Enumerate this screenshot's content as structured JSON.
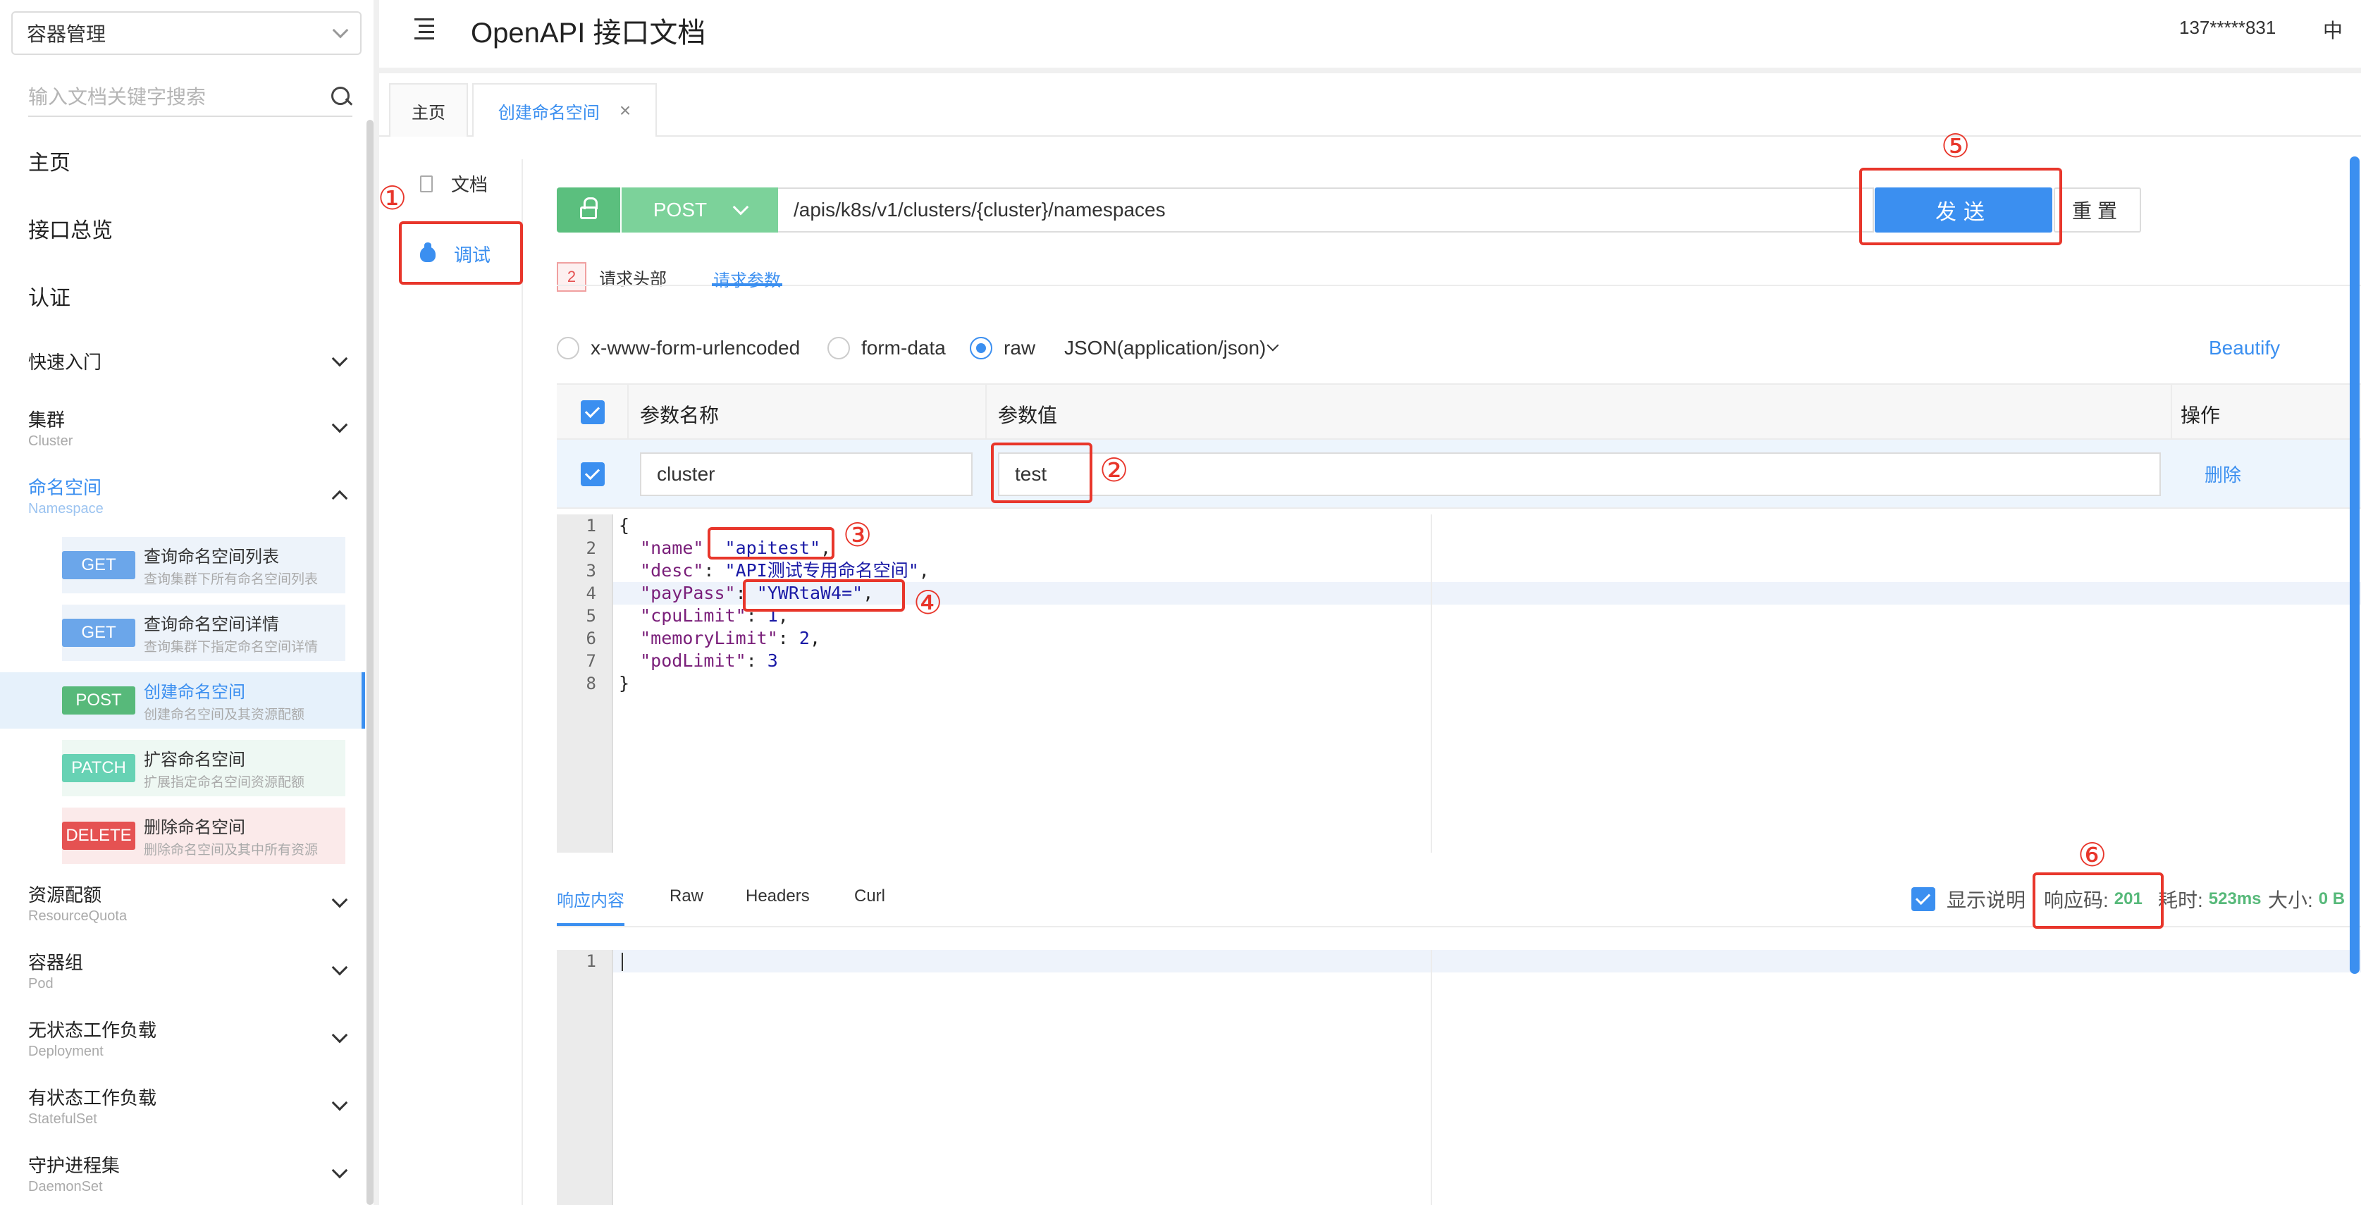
{
  "sidebar": {
    "project": "容器管理",
    "search_placeholder": "输入文档关键字搜索",
    "top_items": [
      "主页",
      "接口总览",
      "认证"
    ],
    "groups": [
      {
        "title": "快速入门",
        "sub": ""
      },
      {
        "title": "集群",
        "sub": "Cluster"
      },
      {
        "title": "命名空间",
        "sub": "Namespace"
      },
      {
        "title": "资源配额",
        "sub": "ResourceQuota"
      },
      {
        "title": "容器组",
        "sub": "Pod"
      },
      {
        "title": "无状态工作负载",
        "sub": "Deployment"
      },
      {
        "title": "有状态工作负载",
        "sub": "StatefulSet"
      },
      {
        "title": "守护进程集",
        "sub": "DaemonSet"
      }
    ],
    "apis": [
      {
        "method": "GET",
        "name": "查询命名空间列表",
        "desc": "查询集群下所有命名空间列表"
      },
      {
        "method": "GET",
        "name": "查询命名空间详情",
        "desc": "查询集群下指定命名空间详情"
      },
      {
        "method": "POST",
        "name": "创建命名空间",
        "desc": "创建命名空间及其资源配额"
      },
      {
        "method": "PATCH",
        "name": "扩容命名空间",
        "desc": "扩展指定命名空间资源配额"
      },
      {
        "method": "DELETE",
        "name": "删除命名空间",
        "desc": "删除命名空间及其中所有资源"
      }
    ]
  },
  "header": {
    "title": "OpenAPI 接口文档",
    "user": "137*****831",
    "lang": "中"
  },
  "tabs": [
    {
      "label": "主页"
    },
    {
      "label": "创建命名空间",
      "close": "×"
    }
  ],
  "subnav": {
    "doc": "文档",
    "debug": "调试"
  },
  "request": {
    "method": "POST",
    "url": "/apis/k8s/v1/clusters/{cluster}/namespaces",
    "send": "发送",
    "reset": "重置"
  },
  "req_tabs": {
    "headers_count": "2",
    "headers": "请求头部",
    "params": "请求参数"
  },
  "body_types": {
    "urlencoded": "x-www-form-urlencoded",
    "formdata": "form-data",
    "raw": "raw",
    "json": "JSON(application/json)",
    "beautify": "Beautify"
  },
  "params_table": {
    "col_name": "参数名称",
    "col_value": "参数值",
    "col_action": "操作",
    "row_name": "cluster",
    "row_value": "test",
    "delete": "删除"
  },
  "code": {
    "lines": [
      "1",
      "2",
      "3",
      "4",
      "5",
      "6",
      "7",
      "8"
    ],
    "open": "{",
    "close": "}",
    "name_key": "\"name\"",
    "name_val": "\"apitest\"",
    "desc_key": "\"desc\"",
    "desc_val": "\"API测试专用命名空间\"",
    "pay_key": "\"payPass\"",
    "pay_val": "\"YWRtaW4=\"",
    "cpu_key": "\"cpuLimit\"",
    "cpu_val": "1",
    "mem_key": "\"memoryLimit\"",
    "mem_val": "2",
    "pod_key": "\"podLimit\"",
    "pod_val": "3"
  },
  "response": {
    "tabs": [
      "响应内容",
      "Raw",
      "Headers",
      "Curl"
    ],
    "show_desc": "显示说明",
    "code_label": "响应码:",
    "code": "201",
    "time_label": "耗时:",
    "time": "523ms",
    "size_label": "大小:",
    "size": "0 B",
    "line": "1"
  },
  "annotations": [
    "①",
    "②",
    "③",
    "④",
    "⑤",
    "⑥"
  ]
}
